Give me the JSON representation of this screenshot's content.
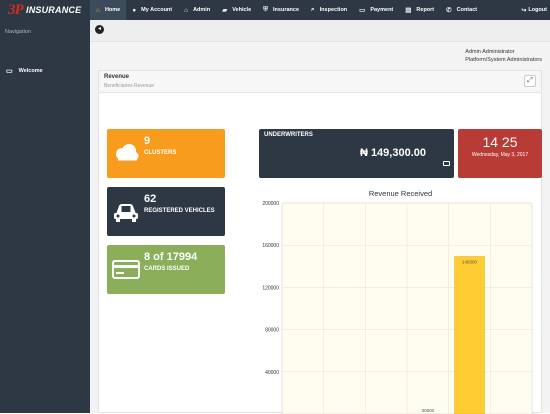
{
  "brand": {
    "mark": "3P",
    "word": "INSURANCE",
    "mark_color": "#d62b1f"
  },
  "nav": {
    "items": [
      {
        "label": "Home",
        "icon": "home-icon",
        "glyph": "⌂",
        "active": true
      },
      {
        "label": "My Account",
        "icon": "user-icon",
        "glyph": "👤",
        "active": false
      },
      {
        "label": "Admin",
        "icon": "lock-icon",
        "glyph": "🔒",
        "active": false
      },
      {
        "label": "Vehicle",
        "icon": "car-icon",
        "glyph": "🚗",
        "active": false
      },
      {
        "label": "Insurance",
        "icon": "shield-icon",
        "glyph": "⛨",
        "active": false
      },
      {
        "label": "Inspection",
        "icon": "search-icon",
        "glyph": "⌕",
        "active": false
      },
      {
        "label": "Payment",
        "icon": "credit-card-icon",
        "glyph": "▭",
        "active": false
      },
      {
        "label": "Report",
        "icon": "file-icon",
        "glyph": "▤",
        "active": false
      },
      {
        "label": "Contact",
        "icon": "phone-icon",
        "glyph": "✆",
        "active": false
      }
    ],
    "logout": "Logout",
    "accent": "#f6a623"
  },
  "sidebar": {
    "title": "Navigation",
    "items": [
      {
        "label": "Welcome",
        "icon": "monitor-icon",
        "glyph": "▭"
      }
    ]
  },
  "user": {
    "name": "Admin Administrator",
    "role": "Platform/System Administrators"
  },
  "panel": {
    "title": "Revenue",
    "subtitle": "Beneficiaries Revenue"
  },
  "tiles": [
    {
      "value": "9",
      "label": "CLUSTERS",
      "icon": "cloud-icon",
      "color": "#f79c1c"
    },
    {
      "value": "62",
      "label": "REGISTERED VEHICLES",
      "icon": "car-icon",
      "color": "#2d3844"
    },
    {
      "value": "8 of 17994",
      "label": "CARDS ISSUED",
      "icon": "credit-card-icon",
      "color": "#8aae59"
    }
  ],
  "underwriters": {
    "title": "UNDERWRITERS",
    "value": "₦ 149,300.00",
    "icon": "money-icon"
  },
  "date": {
    "time": "14 25",
    "day": "Wednesday, May 3, 2017",
    "color": "#b83b36"
  },
  "chart_data": {
    "type": "bar",
    "title": "Revenue Received",
    "categories": [
      "",
      "",
      "",
      "",
      "",
      ""
    ],
    "values": [
      0,
      0,
      0,
      30600,
      149300,
      0
    ],
    "value_labels": [
      "",
      "",
      "",
      "30600",
      "149300",
      ""
    ],
    "yticks": [
      "200000",
      "160000",
      "120000",
      "80000",
      "40000"
    ],
    "ylim": [
      0,
      200000
    ],
    "grid": true,
    "bar_color": "#ffcc33",
    "background": "#fffdf0"
  }
}
